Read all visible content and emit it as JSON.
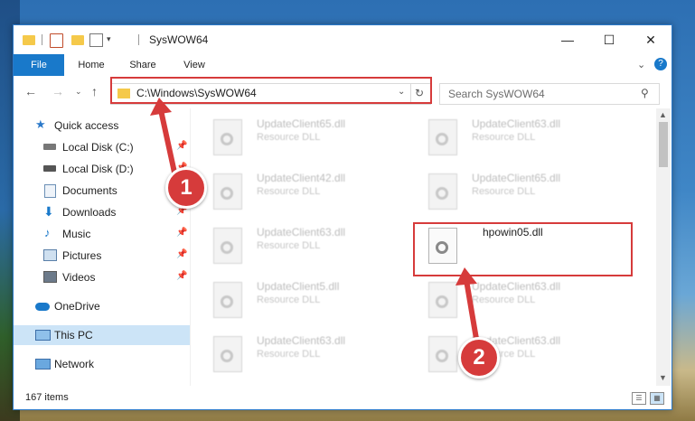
{
  "window": {
    "title": "SysWOW64",
    "minimize_icon": "minimize-icon",
    "maximize_icon": "maximize-icon",
    "close_icon": "close-icon"
  },
  "ribbon": {
    "tabs": [
      "File",
      "Home",
      "Share",
      "View"
    ],
    "accent": "#1979ca"
  },
  "address": {
    "path": "C:\\Windows\\SysWOW64",
    "search_placeholder": "Search SysWOW64"
  },
  "sidebar": {
    "items": [
      {
        "label": "Quick access",
        "icon": "star-icon"
      },
      {
        "label": "Local Disk (C:)",
        "icon": "drive-icon"
      },
      {
        "label": "Local Disk (D:)",
        "icon": "drive-icon"
      },
      {
        "label": "Documents",
        "icon": "documents-icon"
      },
      {
        "label": "Downloads",
        "icon": "download-icon"
      },
      {
        "label": "Music",
        "icon": "music-icon"
      },
      {
        "label": "Pictures",
        "icon": "pictures-icon"
      },
      {
        "label": "Videos",
        "icon": "videos-icon"
      },
      {
        "label": "OneDrive",
        "icon": "cloud-icon"
      },
      {
        "label": "This PC",
        "icon": "computer-icon"
      },
      {
        "label": "Network",
        "icon": "network-icon"
      }
    ]
  },
  "files": [
    {
      "name": "UpdateClient65.dll",
      "type": "Resource DLL"
    },
    {
      "name": "UpdateClient63.dll",
      "type": "Resource DLL"
    },
    {
      "name": "UpdateClient42.dll",
      "type": "Resource DLL"
    },
    {
      "name": "UpdateClient65.dll",
      "type": "Resource DLL"
    },
    {
      "name": "UpdateClient63.dll",
      "type": "Resource DLL"
    },
    {
      "name": "hpowin05.dll",
      "type": ""
    },
    {
      "name": "UpdateClient5.dll",
      "type": "Resource DLL"
    },
    {
      "name": "UpdateClient63.dll",
      "type": "Resource DLL"
    },
    {
      "name": "UpdateClient63.dll",
      "type": "Resource DLL"
    },
    {
      "name": "UpdateClient63.dll",
      "type": "Resource DLL"
    }
  ],
  "status": {
    "item_count": "167 items"
  },
  "callouts": [
    "1",
    "2"
  ],
  "highlight_color": "#d63b3b"
}
